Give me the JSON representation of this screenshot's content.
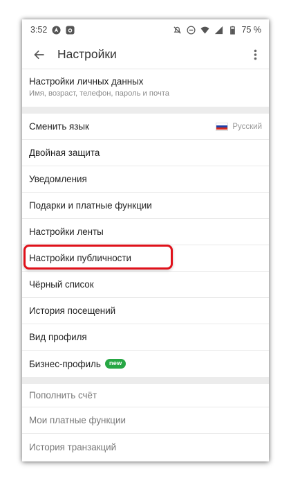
{
  "status_bar": {
    "time": "3:52",
    "battery": "75 %",
    "left_icons": [
      "navigation-icon",
      "camera-icon"
    ],
    "right_icons": [
      "mute-icon",
      "do-not-disturb-icon",
      "wifi-icon",
      "signal-icon",
      "battery-icon"
    ]
  },
  "app_bar": {
    "title": "Настройки",
    "back_icon": "arrow-left-icon",
    "menu_icon": "more-vertical-icon"
  },
  "personal": {
    "label": "Настройки личных данных",
    "sub": "Имя, возраст, телефон, пароль и почта"
  },
  "language": {
    "label": "Сменить язык",
    "value": "Русский",
    "flag_colors": [
      "#ffffff",
      "#1e3fa8",
      "#d52b1e"
    ]
  },
  "items": [
    {
      "label": "Двойная защита"
    },
    {
      "label": "Уведомления"
    },
    {
      "label": "Подарки и платные функции"
    },
    {
      "label": "Настройки ленты"
    },
    {
      "label": "Настройки публичности"
    },
    {
      "label": "Чёрный список"
    },
    {
      "label": "История посещений"
    },
    {
      "label": "Вид профиля"
    }
  ],
  "business": {
    "label": "Бизнес-профиль",
    "badge": "new"
  },
  "payments": [
    {
      "label": "Пополнить счёт"
    },
    {
      "label": "Мои платные функции"
    },
    {
      "label": "История транзакций"
    }
  ],
  "colors": {
    "highlight": "#e0111a",
    "badge": "#27a744"
  }
}
